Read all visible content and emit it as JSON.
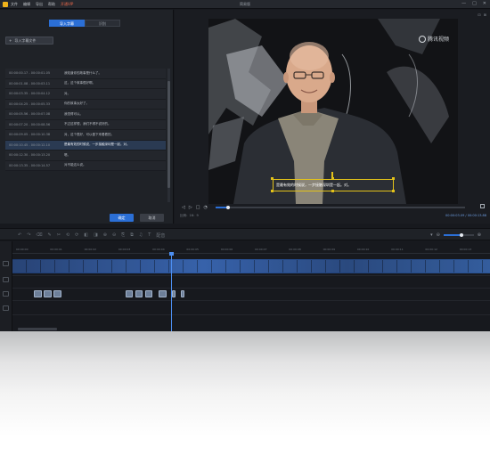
{
  "window": {
    "title": "简易版",
    "menu": [
      "文件",
      "编辑",
      "导出",
      "帮助"
    ],
    "vip_label": "开通VIP",
    "controls": [
      "—",
      "□",
      "✕"
    ]
  },
  "subtitle_panel": {
    "tabs": [
      {
        "label": "导入字幕",
        "active": true
      },
      {
        "label": "识别",
        "active": false
      }
    ],
    "import_button": "导入字幕文件",
    "rows": [
      {
        "time": "00:00:00.17 - 00:00:01.05",
        "text": "我知道你的故事是什么了。",
        "highlighted": false
      },
      {
        "time": "00:00:01.08 - 00:00:03.11",
        "text": "这，这个故事很好啊。",
        "highlighted": false
      },
      {
        "time": "00:00:03.35 - 00:00:04.12",
        "text": "对。",
        "highlighted": false
      },
      {
        "time": "00:00:04.25 - 00:00:05.33",
        "text": "你的故事太好了。",
        "highlighted": false
      },
      {
        "time": "00:00:05.56 - 00:00:07.08",
        "text": "我觉得可以。",
        "highlighted": false
      },
      {
        "time": "00:00:07.20 - 00:00:08.56",
        "text": "不过这样想，我们不得不说好的。",
        "highlighted": false
      },
      {
        "time": "00:00:09.05 - 00:00:10.38",
        "text": "对，这个很好，可以做下来看看的。",
        "highlighted": false
      },
      {
        "time": "00:00:10.45 - 00:00:12.10",
        "text": "是最有效的时候说，一步接触深圳是一起。对。",
        "highlighted": true
      },
      {
        "time": "00:00:12.30 - 00:00:13.20",
        "text": "嗯。",
        "highlighted": false
      },
      {
        "time": "00:00:13.35 - 00:00:14.57",
        "text": "对不能这么说。",
        "highlighted": false
      }
    ],
    "confirm_label": "确定",
    "cancel_label": "取消"
  },
  "preview": {
    "watermark": "腾讯视频",
    "subtitle_overlay": "是最有效的时候说，一步接触深圳是一起。对。",
    "ratio_label": "比例：16：9",
    "time_display": "00:00:03.09 / 00:00:13.88",
    "progress": 0.05,
    "tools": [
      "⊡",
      "⊞"
    ]
  },
  "timeline": {
    "ruler_ticks": [
      "00:00:00",
      "00:00:01",
      "00:00:02",
      "00:00:03",
      "00:00:04",
      "00:00:05",
      "00:00:06",
      "00:00:07",
      "00:00:08",
      "00:00:09",
      "00:00:10",
      "00:00:11",
      "00:00:12",
      "00:00:13"
    ],
    "tools": [
      "↶",
      "↷",
      "⌫",
      "✎",
      "✂",
      "⟲",
      "⟳",
      "◧",
      "◨",
      "⊕",
      "⊖",
      "⎘",
      "⧉",
      "♫",
      "T"
    ],
    "tool_label": "配音",
    "zoom_level": 0.6
  },
  "colors": {
    "accent": "#2b6fd6",
    "subtitle_border": "#e3c21a",
    "vip": "#f06a4a",
    "background": "#17191e"
  }
}
